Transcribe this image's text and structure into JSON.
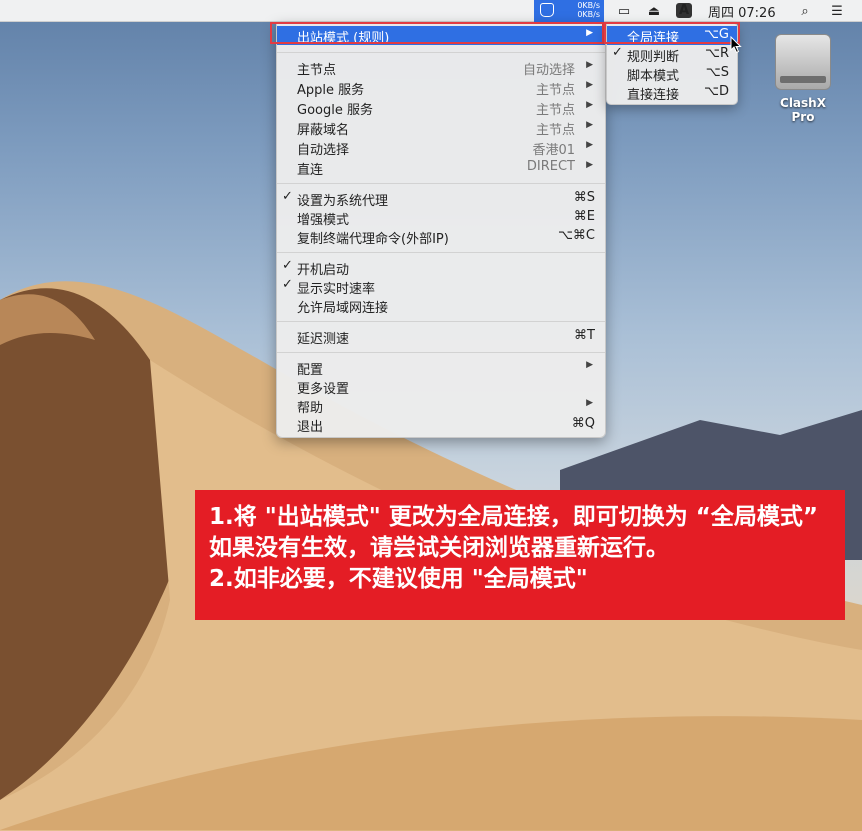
{
  "menubar": {
    "clash_speed_up": "0KB/s",
    "clash_speed_down": "0KB/s",
    "input_source": "A",
    "clock": "周四 07:26",
    "icons": [
      "clash-cat-icon",
      "display-icon",
      "eject-icon",
      "input-source-icon",
      "spotlight-icon",
      "list-icon"
    ]
  },
  "desktop": {
    "drive_label": "ClashX Pro"
  },
  "main_menu": {
    "outbound": {
      "label": "出站模式 (规则)",
      "arrow": "▶"
    },
    "proxies": [
      {
        "label": "主节点",
        "value": "自动选择",
        "arrow": "▶"
      },
      {
        "label": "Apple 服务",
        "value": "主节点",
        "arrow": "▶"
      },
      {
        "label": "Google 服务",
        "value": "主节点",
        "arrow": "▶"
      },
      {
        "label": "屏蔽域名",
        "value": "主节点",
        "arrow": "▶"
      },
      {
        "label": "自动选择",
        "value": "香港01",
        "arrow": "▶"
      },
      {
        "label": "直连",
        "value": "DIRECT",
        "arrow": "▶"
      }
    ],
    "settings": [
      {
        "check": "✓",
        "label": "设置为系统代理",
        "shortcut": "⌘S"
      },
      {
        "check": "",
        "label": "增强模式",
        "shortcut": "⌘E"
      },
      {
        "check": "",
        "label": "复制终端代理命令(外部IP)",
        "shortcut": "⌥⌘C"
      }
    ],
    "toggles": [
      {
        "check": "✓",
        "label": "开机启动"
      },
      {
        "check": "✓",
        "label": "显示实时速率"
      },
      {
        "check": "",
        "label": "允许局域网连接"
      }
    ],
    "latency": {
      "label": "延迟测速",
      "shortcut": "⌘T"
    },
    "more": [
      {
        "label": "配置",
        "arrow": "▶",
        "shortcut": ""
      },
      {
        "label": "更多设置",
        "arrow": "",
        "shortcut": ""
      },
      {
        "label": "帮助",
        "arrow": "▶",
        "shortcut": ""
      },
      {
        "label": "退出",
        "arrow": "",
        "shortcut": "⌘Q"
      }
    ]
  },
  "sub_menu": {
    "items": [
      {
        "check": "",
        "label": "全局连接",
        "shortcut": "⌥G",
        "selected": true
      },
      {
        "check": "✓",
        "label": "规则判断",
        "shortcut": "⌥R"
      },
      {
        "check": "",
        "label": "脚本模式",
        "shortcut": "⌥S"
      },
      {
        "check": "",
        "label": "直接连接",
        "shortcut": "⌥D"
      }
    ]
  },
  "notice": {
    "line1": "1.将 \"出站模式\" 更改为全局连接，即可切换为 “全局模式”",
    "line2": "如果没有生效，请尝试关闭浏览器重新运行。",
    "line3": "2.如非必要，不建议使用 \"全局模式\""
  },
  "colors": {
    "highlight": "#2f6fe3",
    "annotation_red": "#e41d25",
    "menu_bg": "#ececec"
  }
}
